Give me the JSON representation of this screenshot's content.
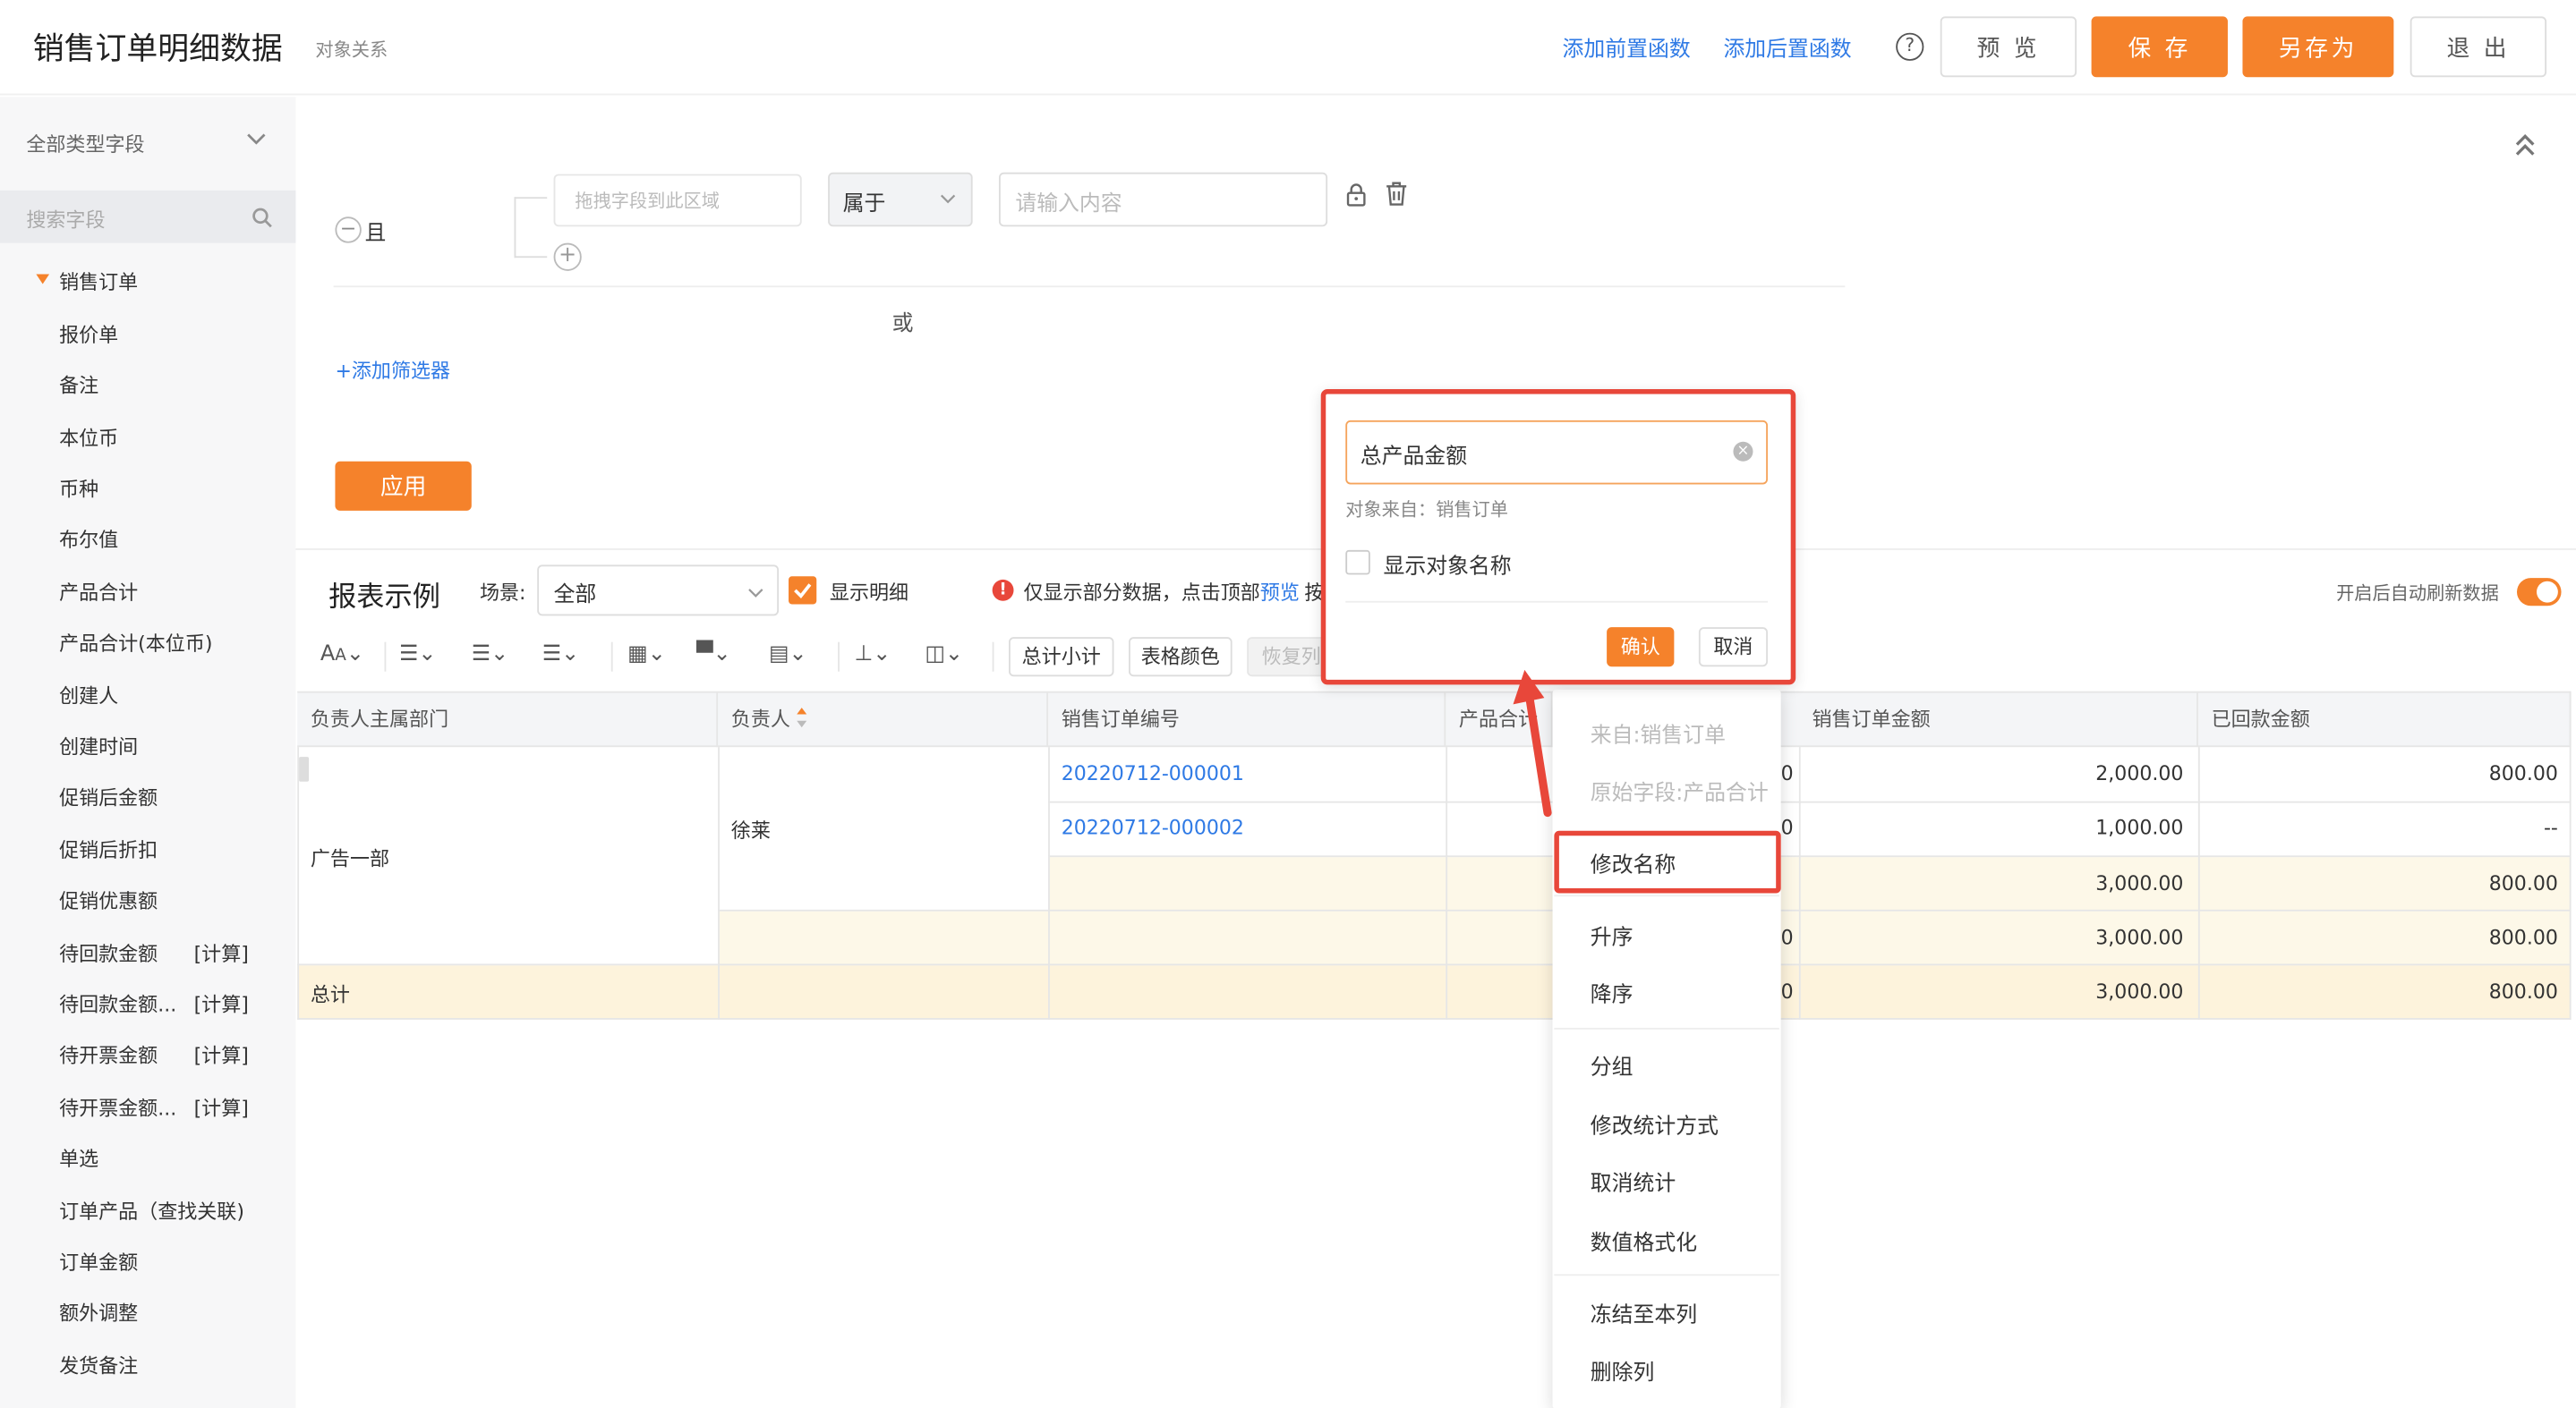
{
  "header": {
    "title": "销售订单明细数据",
    "subtitle": "对象关系",
    "add_pre_func": "添加前置函数",
    "add_post_func": "添加后置函数",
    "help_icon": "question-circle-icon",
    "preview": "预 览",
    "save": "保 存",
    "save_as": "另存为",
    "exit": "退 出"
  },
  "sidebar": {
    "filter_label": "全部类型字段",
    "search_placeholder": "搜索字段",
    "group": "销售订单",
    "items": [
      {
        "label": "报价单",
        "tag": ""
      },
      {
        "label": "备注",
        "tag": ""
      },
      {
        "label": "本位币",
        "tag": ""
      },
      {
        "label": "币种",
        "tag": ""
      },
      {
        "label": "布尔值",
        "tag": ""
      },
      {
        "label": "产品合计",
        "tag": ""
      },
      {
        "label": "产品合计(本位币)",
        "tag": ""
      },
      {
        "label": "创建人",
        "tag": ""
      },
      {
        "label": "创建时间",
        "tag": ""
      },
      {
        "label": "促销后金额",
        "tag": ""
      },
      {
        "label": "促销后折扣",
        "tag": ""
      },
      {
        "label": "促销优惠额",
        "tag": ""
      },
      {
        "label": "待回款金额",
        "tag": "[计算]"
      },
      {
        "label": "待回款金额...",
        "tag": "[计算]"
      },
      {
        "label": "待开票金额",
        "tag": "[计算]"
      },
      {
        "label": "待开票金额...",
        "tag": "[计算]"
      },
      {
        "label": "单选",
        "tag": ""
      },
      {
        "label": "订单产品（查找关联)",
        "tag": ""
      },
      {
        "label": "订单金额",
        "tag": ""
      },
      {
        "label": "额外调整",
        "tag": ""
      },
      {
        "label": "发货备注",
        "tag": ""
      }
    ]
  },
  "filter": {
    "and_label": "且",
    "drag_placeholder": "拖拽字段到此区域",
    "operator": "属于",
    "value_placeholder": "请输入内容",
    "or_label": "或",
    "add_filter": "+添加筛选器",
    "apply": "应用"
  },
  "report": {
    "title": "报表示例",
    "scene_label": "场景:",
    "scene_value": "全部",
    "show_detail": "显示明细",
    "partial_notice": "仅显示部分数据，点击顶部",
    "preview_link": "预览",
    "notice_tail": "按",
    "auto_refresh": "开启后自动刷新数据",
    "subtotal_btn": "总计小计",
    "color_btn": "表格颜色",
    "restore_btn": "恢复列"
  },
  "table": {
    "headers": [
      "负责人主属部门",
      "负责人",
      "销售订单编号",
      "产品合计",
      "销售订单金额",
      "已回款金额"
    ],
    "department": "广告一部",
    "owner": "徐莱",
    "rows": [
      {
        "order_no": "20220712-000001",
        "amount": "2,000.00",
        "received": "800.00",
        "tail": "0"
      },
      {
        "order_no": "20220712-000002",
        "amount": "1,000.00",
        "received": "--",
        "tail": "0"
      },
      {
        "order_no": "",
        "amount": "3,000.00",
        "received": "800.00",
        "tail": ""
      },
      {
        "order_no": "",
        "amount": "3,000.00",
        "received": "800.00",
        "tail": "0"
      }
    ],
    "total_label": "总计",
    "total_amount": "3,000.00",
    "total_received": "800.00",
    "total_tail": "0"
  },
  "rename_popup": {
    "input_value": "总产品金额",
    "source": "对象来自：销售订单",
    "show_object_name": "显示对象名称",
    "confirm": "确认",
    "cancel": "取消"
  },
  "context_menu": {
    "from": "来自:销售订单",
    "original": "原始字段:产品合计",
    "rename": "修改名称",
    "asc": "升序",
    "desc": "降序",
    "group": "分组",
    "change_stat": "修改统计方式",
    "cancel_stat": "取消统计",
    "num_format": "数值格式化",
    "freeze": "冻结至本列",
    "delete_col": "删除列"
  },
  "colors": {
    "accent": "#f5822b",
    "link": "#2f7ae5",
    "highlight": "#e8473a"
  }
}
